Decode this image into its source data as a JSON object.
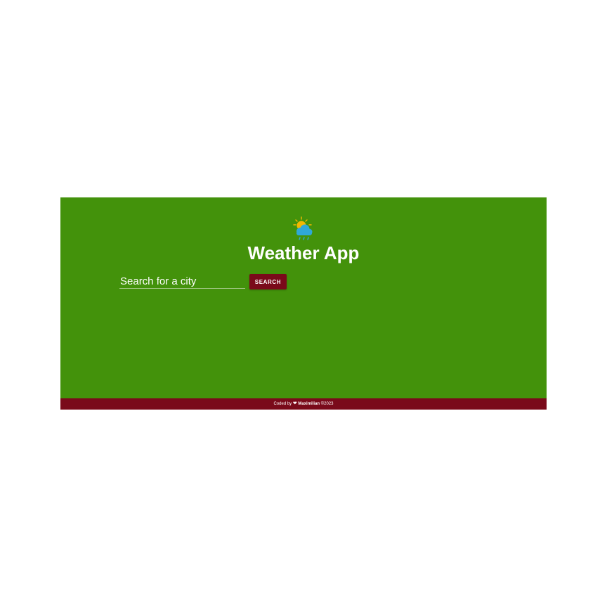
{
  "app": {
    "title": "Weather App",
    "logo_icon": "sun-cloud-rain-icon"
  },
  "search": {
    "placeholder": "Search for a city",
    "value": "",
    "button_label": "SEARCH"
  },
  "footer": {
    "prefix": "Coded by",
    "heart": "❤",
    "author": "Maximilian",
    "suffix": "©2023"
  },
  "colors": {
    "background": "#43920b",
    "accent": "#7a0a1a",
    "text": "#ffffff",
    "sun": "#f5b800",
    "cloud": "#2fa8d8"
  }
}
